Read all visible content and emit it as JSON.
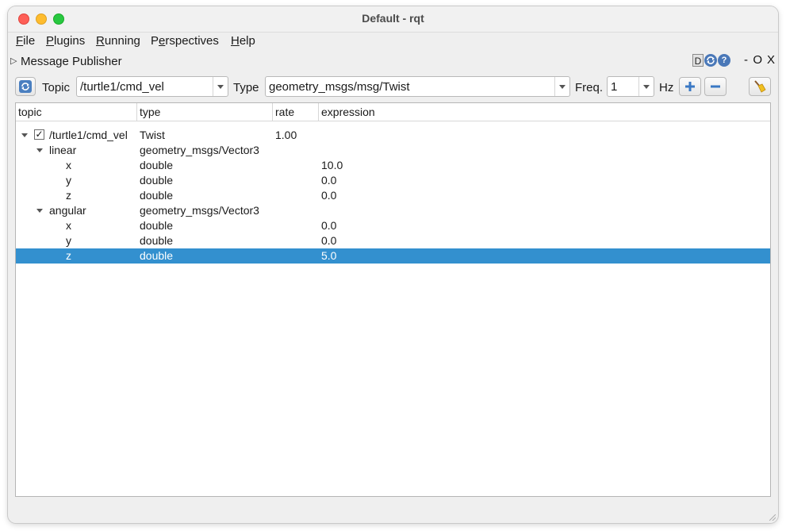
{
  "window": {
    "title": "Default - rqt"
  },
  "menubar": {
    "items": [
      {
        "underline": "F",
        "rest": "ile"
      },
      {
        "underline": "P",
        "rest": "lugins"
      },
      {
        "underline": "R",
        "rest": "unning"
      },
      {
        "pre": "P",
        "underline": "e",
        "rest": "rspectives"
      },
      {
        "underline": "H",
        "rest": "elp"
      }
    ]
  },
  "plugin": {
    "title": "Message Publisher",
    "dock_d": "D",
    "dock_reload_icon": "reload-icon",
    "dock_help": "?",
    "minimize": "-",
    "restore": "O",
    "close": "X"
  },
  "toolbar": {
    "topic_label": "Topic",
    "topic_value": "/turtle1/cmd_vel",
    "type_label": "Type",
    "type_value": "geometry_msgs/msg/Twist",
    "freq_label": "Freq.",
    "freq_value": "1",
    "hz_label": "Hz",
    "add_icon": "+",
    "remove_icon": "−"
  },
  "tree": {
    "columns": [
      "topic",
      "type",
      "rate",
      "expression"
    ],
    "rows": [
      {
        "level": 0,
        "expanded": true,
        "checked": true,
        "check_glyph": "✓",
        "topic": "/turtle1/cmd_vel",
        "type": "Twist",
        "rate": "1.00",
        "expression": ""
      },
      {
        "level": 1,
        "expanded": true,
        "topic": "linear",
        "type": "geometry_msgs/Vector3",
        "rate": "",
        "expression": ""
      },
      {
        "level": 2,
        "topic": "x",
        "type": "double",
        "rate": "",
        "expression": "10.0"
      },
      {
        "level": 2,
        "topic": "y",
        "type": "double",
        "rate": "",
        "expression": "0.0"
      },
      {
        "level": 2,
        "topic": "z",
        "type": "double",
        "rate": "",
        "expression": "0.0"
      },
      {
        "level": 1,
        "expanded": true,
        "topic": "angular",
        "type": "geometry_msgs/Vector3",
        "rate": "",
        "expression": ""
      },
      {
        "level": 2,
        "topic": "x",
        "type": "double",
        "rate": "",
        "expression": "0.0"
      },
      {
        "level": 2,
        "topic": "y",
        "type": "double",
        "rate": "",
        "expression": "0.0"
      },
      {
        "level": 2,
        "topic": "z",
        "type": "double",
        "rate": "",
        "expression": "5.0",
        "selected": true
      }
    ]
  },
  "colors": {
    "selection": "#3390cf",
    "close": "#fe5f57",
    "minimize": "#febc2e",
    "maximize": "#28c840"
  }
}
